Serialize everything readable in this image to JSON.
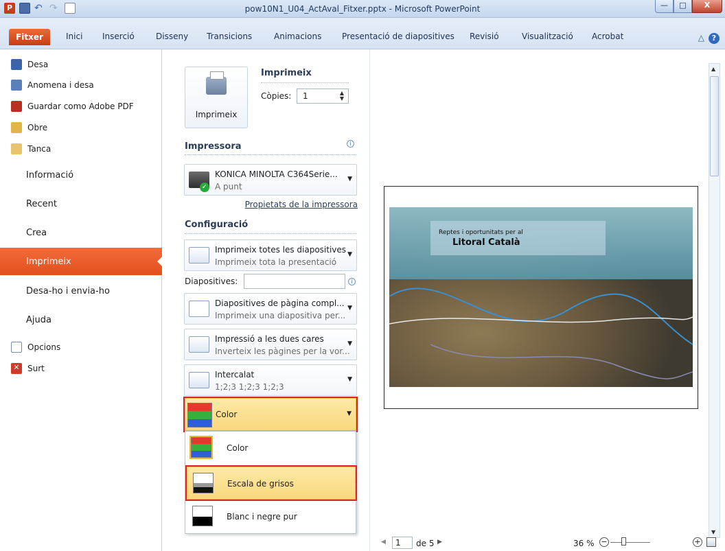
{
  "window": {
    "title": "pow10N1_U04_ActAval_Fitxer.pptx  -  Microsoft PowerPoint",
    "app_icon_letter": "P",
    "minimize": "—",
    "maximize": "□",
    "close": "X"
  },
  "ribbon": {
    "tabs": [
      "Fitxer",
      "Inici",
      "Inserció",
      "Disseny",
      "Transicions",
      "Animacions",
      "Presentació de diapositives",
      "Revisió",
      "Visualització",
      "Acrobat"
    ],
    "help": "?",
    "collapse": "△"
  },
  "backstage": {
    "quick": [
      {
        "label": "Desa",
        "icon": "save-icon"
      },
      {
        "label": "Anomena i desa",
        "icon": "save-as-icon"
      },
      {
        "label": "Guardar como Adobe PDF",
        "icon": "pdf-icon"
      },
      {
        "label": "Obre",
        "icon": "open-folder-icon"
      },
      {
        "label": "Tanca",
        "icon": "close-file-icon"
      }
    ],
    "sections": [
      "Informació",
      "Recent",
      "Crea",
      "Imprimeix",
      "Desa-ho i envia-ho",
      "Ajuda"
    ],
    "active_section": "Imprimeix",
    "bottom": [
      {
        "label": "Opcions",
        "icon": "options-icon"
      },
      {
        "label": "Surt",
        "icon": "exit-icon"
      }
    ],
    "exit_glyph": "✕"
  },
  "print": {
    "heading": "Imprimeix",
    "button_label": "Imprimeix",
    "copies_label": "Còpies:",
    "copies_value": "1",
    "spin_up": "▲",
    "spin_down": "▼",
    "printer_heading": "Impressora",
    "printer_name": "KONICA MINOLTA C364Serie...",
    "printer_status": "A punt",
    "printer_properties": "Propietats de la impressora",
    "config_heading": "Configuració",
    "info_glyph": "i",
    "dropdown_arrow": "▼",
    "settings": [
      {
        "line1": "Imprimeix totes les diapositives",
        "line2": "Imprimeix tota la presentació"
      },
      {
        "line1": "Diapositives de pàgina compl...",
        "line2": "Imprimeix una diapositiva per..."
      },
      {
        "line1": "Impressió a les dues cares",
        "line2": "Inverteix les pàgines per la vor..."
      },
      {
        "line1": "Intercalat",
        "line2": "1;2;3   1;2;3   1;2;3"
      }
    ],
    "slides_label": "Diapositives:",
    "slides_value": "",
    "color_selected": "Color",
    "color_options": [
      "Color",
      "Escala de grisos",
      "Blanc i negre pur"
    ],
    "highlighted_option": "Escala de grisos"
  },
  "preview": {
    "slide_line1": "Reptes i oportunitats per al",
    "slide_line2": "Litoral Català",
    "page_current": "1",
    "page_total": "de 5",
    "prev_glyph": "◀",
    "next_glyph": "▶",
    "zoom": "36 %",
    "zoom_out": "−",
    "zoom_in": "+",
    "scroll_up": "▲",
    "scroll_down": "▼"
  },
  "colors": {
    "accent_file_tab": "#d24a1a",
    "active_menu": "#f26b3a",
    "highlight": "#fbe29a",
    "annotation_outline": "#d9262d"
  }
}
